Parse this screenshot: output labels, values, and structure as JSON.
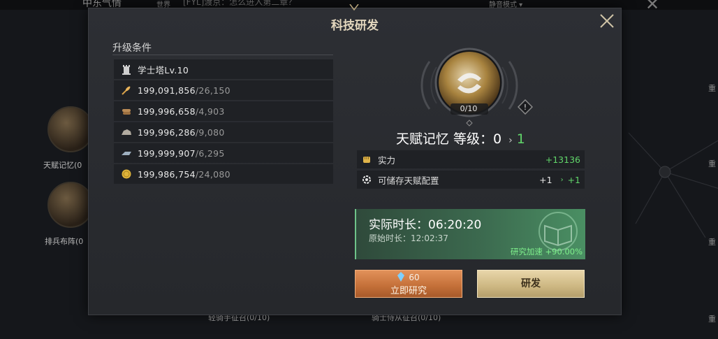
{
  "background": {
    "header_title": "中东气情",
    "chat_tag": "世界",
    "chat_text": "[FYL]渡京：怎么进入第二章？",
    "sound_mode": "静音模式",
    "left_nodes": [
      {
        "label": "天赋记忆(0"
      },
      {
        "label": "排兵布阵(0"
      }
    ],
    "right_labels": [
      "重",
      "重",
      "重",
      "重"
    ],
    "bottom_labels": [
      "轻骑手征召(0/10)",
      "骑士侍从征召(0/10)"
    ]
  },
  "dialog": {
    "title": "科技研发",
    "requirements": {
      "header": "升级条件",
      "building": "学士塔Lv.10",
      "resources": [
        {
          "icon": "wheat-icon",
          "have": "199,091,856",
          "need": "/26,150"
        },
        {
          "icon": "wood-icon",
          "have": "199,996,658",
          "need": "/4,903"
        },
        {
          "icon": "stone-icon",
          "have": "199,996,286",
          "need": "/9,080"
        },
        {
          "icon": "iron-icon",
          "have": "199,999,907",
          "need": "/6,295"
        },
        {
          "icon": "gold-icon",
          "have": "199,986,754",
          "need": "/24,080"
        }
      ]
    },
    "talent": {
      "progress": "0/10",
      "name_level": "天赋记忆 等级：0",
      "next_level": "1"
    },
    "stats": [
      {
        "icon": "fist-icon",
        "label": "实力",
        "value": "+13136"
      },
      {
        "icon": "gear-icon",
        "label": "可储存天赋配置",
        "current": "+1",
        "value": "+1"
      }
    ],
    "time": {
      "actual": "实际时长：06:20:20",
      "original": "原始时长：12:02:37",
      "speed": "研究加速 +90.00%"
    },
    "buttons": {
      "instant_cost": "60",
      "instant_label": "立即研究",
      "research_label": "研发"
    }
  },
  "colors": {
    "accent_green": "#61d66a",
    "instant_button": "#c36f38",
    "research_button": "#cdb782"
  }
}
